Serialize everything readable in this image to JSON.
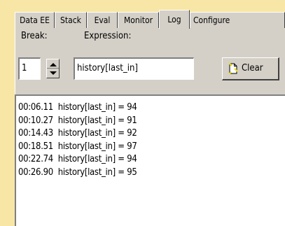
{
  "tabs": [
    {
      "label": "Data EE",
      "active": false
    },
    {
      "label": "Stack",
      "active": false
    },
    {
      "label": "Eval",
      "active": false
    },
    {
      "label": "Monitor",
      "active": false
    },
    {
      "label": "Log",
      "active": true
    },
    {
      "label": "Configure",
      "active": false
    }
  ],
  "controls": {
    "break_label": "Break:",
    "break_value": "1",
    "expression_label": "Expression:",
    "expression_value": "history[last_in]",
    "clear_label": "Clear"
  },
  "log": [
    "00:06.11  history[last_in] = 94",
    "00:10.27  history[last_in] = 91",
    "00:14.43  history[last_in] = 92",
    "00:18.51  history[last_in] = 97",
    "00:22.74  history[last_in] = 94",
    "00:26.90  history[last_in] = 95"
  ],
  "icons": {
    "clear": "clear-document-icon",
    "spinner_up": "arrow-up-icon",
    "spinner_down": "arrow-down-icon"
  },
  "colors": {
    "background": "#f7e6a6",
    "panel": "#d4d0c8",
    "icon_yellow": "#f0e000"
  }
}
